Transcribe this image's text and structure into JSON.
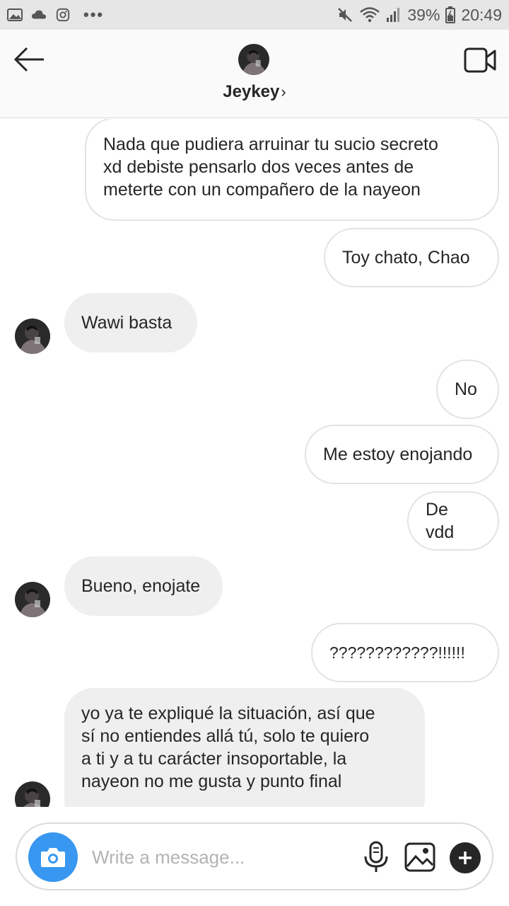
{
  "status_bar": {
    "left_icons": [
      "gallery-icon",
      "cloud-icon",
      "instagram-icon",
      "more-dots-icon"
    ],
    "right_icons": [
      "mute-icon",
      "wifi-icon",
      "signal-icon",
      "battery-icon"
    ],
    "battery": "39%",
    "time": "20:49"
  },
  "header": {
    "contact_name": "Jeykey",
    "chevron": "›"
  },
  "messages": [
    {
      "side": "out",
      "lines": [
        "Nada que pudiera arruinar tu sucio secreto",
        "xd debiste pensarlo dos veces antes de",
        "meterte con un compañero de la nayeon"
      ]
    },
    {
      "side": "out",
      "text": "Toy chato, Chao"
    },
    {
      "side": "in",
      "text": "Wawi basta"
    },
    {
      "side": "out",
      "text": "No"
    },
    {
      "side": "out",
      "text": "Me estoy enojando"
    },
    {
      "side": "out",
      "text": "De vdd"
    },
    {
      "side": "in",
      "text": "Bueno, enojate"
    },
    {
      "side": "out",
      "text": "????????????!!!!!!"
    },
    {
      "side": "in",
      "lines": [
        "yo ya te expliqué la situación, así que",
        "sí no entiendes allá tú, solo te quiero",
        "a ti y a tu carácter insoportable, la",
        "nayeon no me gusta y punto final"
      ]
    }
  ],
  "composer": {
    "placeholder": "Write a message...",
    "camera_icon": "camera-icon",
    "mic_icon": "microphone-icon",
    "gallery_icon": "image-icon",
    "plus_icon": "plus-icon"
  },
  "colors": {
    "accent": "#3897f0",
    "incoming_bubble": "#efefef",
    "outgoing_border": "#e3e3e3",
    "status_bar": "#e6e6e6"
  }
}
